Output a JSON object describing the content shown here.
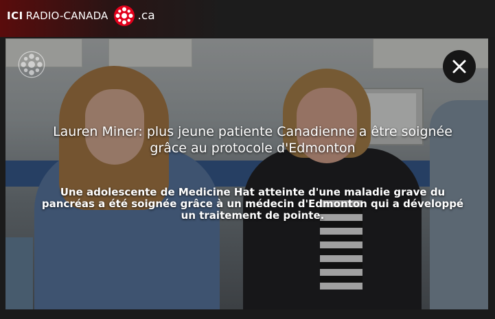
{
  "header": {
    "logo_ici": "ICI",
    "logo_radio_canada": "RADIO-CANADA",
    "logo_domain": ".ca",
    "logo_icon": "radio-canada-gem-icon",
    "brand_color": "#e3001b"
  },
  "video": {
    "title": "Lauren Miner: plus jeune patiente Canadienne a être soignée grâce au protocole d'Edmonton",
    "description": "Une adolescente de Medicine Hat atteinte d'une maladie grave du pancréas a été soignée grâce à un médecin d'Edmonton qui a développé un traitement de pointe.",
    "watermark_icon": "radio-canada-gem-icon",
    "close_icon": "close-icon"
  }
}
